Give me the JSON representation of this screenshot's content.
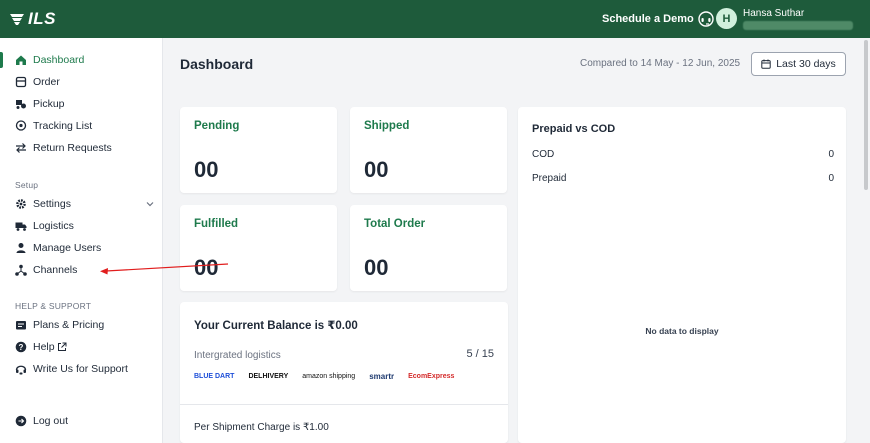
{
  "app": {
    "brand": "ILS"
  },
  "topbar": {
    "schedule_demo": "Schedule a Demo",
    "avatar_initial": "H",
    "user_name": "Hansa Suthar"
  },
  "sidebar": {
    "items": [
      {
        "label": "Dashboard",
        "icon": "home-icon",
        "active": true
      },
      {
        "label": "Order",
        "icon": "order-icon"
      },
      {
        "label": "Pickup",
        "icon": "pickup-icon"
      },
      {
        "label": "Tracking List",
        "icon": "location-pin-icon"
      },
      {
        "label": "Return Requests",
        "icon": "return-arrows-icon"
      }
    ],
    "setup_label": "Setup",
    "setup_items": [
      {
        "label": "Settings",
        "icon": "gear-icon"
      },
      {
        "label": "Logistics",
        "icon": "truck-icon"
      },
      {
        "label": "Manage Users",
        "icon": "user-icon"
      },
      {
        "label": "Channels",
        "icon": "channels-icon"
      }
    ],
    "help_label": "HELP & SUPPORT",
    "help_items": [
      {
        "label": "Plans & Pricing",
        "icon": "pricing-icon"
      },
      {
        "label": "Help",
        "icon": "help-icon"
      },
      {
        "label": "Write Us for Support",
        "icon": "support-icon"
      }
    ],
    "logout": "Log out"
  },
  "main": {
    "title": "Dashboard",
    "compared_to": "Compared to 14 May - 12 Jun, 2025",
    "range_button": "Last 30 days",
    "stats": [
      {
        "label": "Pending",
        "value": "00"
      },
      {
        "label": "Shipped",
        "value": "00"
      },
      {
        "label": "Fulfilled",
        "value": "00"
      },
      {
        "label": "Total Order",
        "value": "00"
      }
    ],
    "prepaid_vs_cod": {
      "title": "Prepaid vs COD",
      "rows": [
        {
          "label": "COD",
          "value": "0"
        },
        {
          "label": "Prepaid",
          "value": "0"
        }
      ],
      "empty_text": "No data to display"
    },
    "balance": {
      "title": "Your Current Balance is ₹0.00",
      "integrated_label": "Intergrated logistics",
      "integrated_count": "5 / 15",
      "partners": [
        {
          "name": "BLUE DART",
          "color": "#1d4ed8"
        },
        {
          "name": "DELHIVERY",
          "color": "#111111"
        },
        {
          "name": "amazon shipping",
          "color": "#111111"
        },
        {
          "name": "smartr",
          "color": "#1f3b70"
        },
        {
          "name": "EcomExpress",
          "color": "#d42a2a"
        }
      ],
      "per_shipment": "Per Shipment Charge is ₹1.00"
    }
  },
  "colors": {
    "brand_green": "#1e5b3b",
    "accent_green": "#1e7a4c",
    "annotation_red": "#e11d1d"
  }
}
